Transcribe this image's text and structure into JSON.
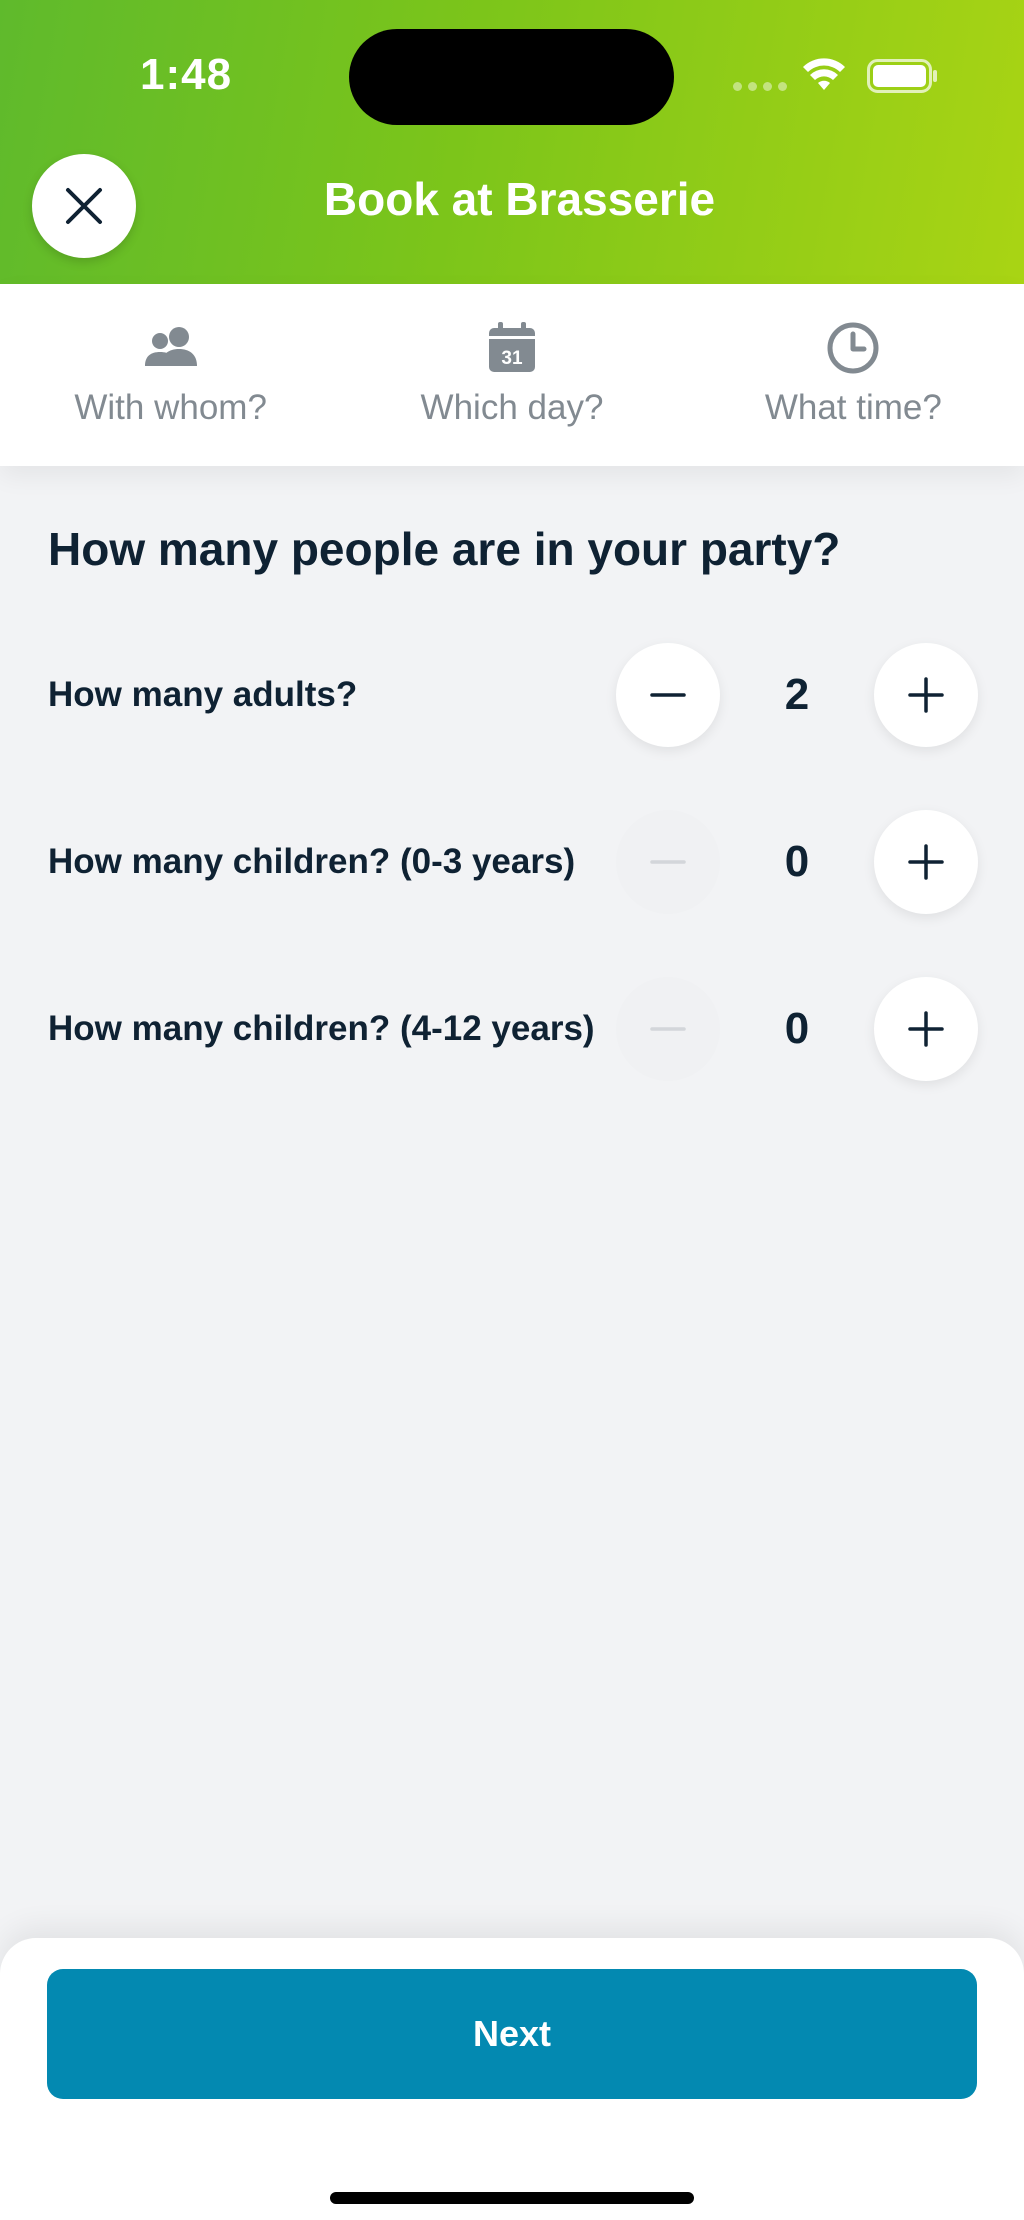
{
  "status_bar": {
    "time": "1:48"
  },
  "header": {
    "title": "Book at Brasserie",
    "close_icon": "close-icon"
  },
  "tabs": [
    {
      "label": "With whom?",
      "icon": "people-icon"
    },
    {
      "label": "Which day?",
      "icon": "calendar-icon",
      "icon_text": "31"
    },
    {
      "label": "What time?",
      "icon": "clock-icon"
    }
  ],
  "main": {
    "title": "How many people are in your party?",
    "rows": [
      {
        "label": "How many adults?",
        "value": "2",
        "minus_enabled": true
      },
      {
        "label": "How many children? (0-3 years)",
        "value": "0",
        "minus_enabled": false
      },
      {
        "label": "How many children? (4-12 years)",
        "value": "0",
        "minus_enabled": false
      }
    ]
  },
  "footer": {
    "next_label": "Next"
  },
  "colors": {
    "header_gradient_start": "#5fba2c",
    "header_gradient_end": "#a9d414",
    "primary_button": "#0389b1",
    "text_dark": "#0f2233",
    "tab_gray": "#828a91"
  }
}
